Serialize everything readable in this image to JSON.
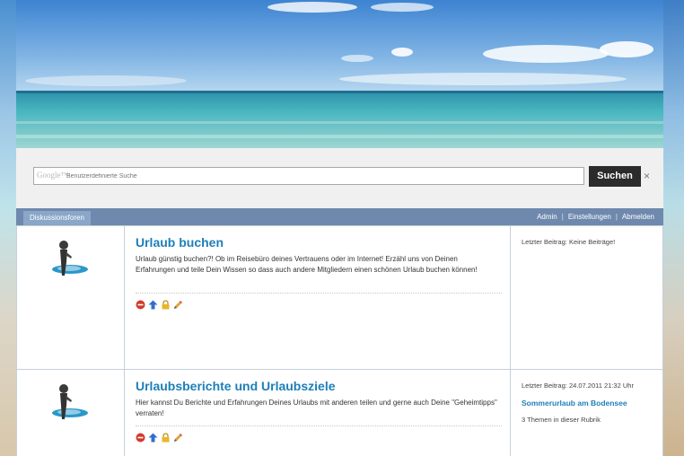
{
  "search": {
    "google_label": "Google™",
    "placeholder": "Benutzerdefinierte Suche",
    "button_label": "Suchen",
    "clear_label": "×"
  },
  "nav": {
    "tab_label": "Diskussionsforen",
    "links": [
      "Admin",
      "Einstellungen",
      "Abmelden"
    ],
    "separator": "|"
  },
  "forums": [
    {
      "title": "Urlaub buchen",
      "description": "Urlaub günstig buchen?! Ob im Reisebüro deines Vertrauens oder im Internet! Erzähl uns von Deinen Erfahrungen und teile Dein Wissen so dass auch andere Mitgliedern einen schönen Urlaub buchen können!",
      "last_post": "Letzter Beitrag: Keine Beiträge!"
    },
    {
      "title": "Urlaubsberichte und Urlaubsziele",
      "description": "Hier kannst Du Berichte und Erfahrungen Deines Urlaubs mit anderen teilen und gerne auch Deine \"Geheimtipps\" verraten!",
      "last_post": "Letzter Beitrag: 24.07.2011 21:32 Uhr",
      "last_topic": "Sommerurlaub am Bodensee",
      "topic_count": "3 Themen in dieser Rubrik"
    }
  ],
  "icons": {
    "forum": "person-on-platform-icon",
    "actions": [
      "delete-icon",
      "move-up-icon",
      "lock-icon",
      "edit-icon"
    ]
  },
  "colors": {
    "navbar": "#6e89ad",
    "title": "#1d7fb8",
    "search_button": "#2b2b2b"
  }
}
